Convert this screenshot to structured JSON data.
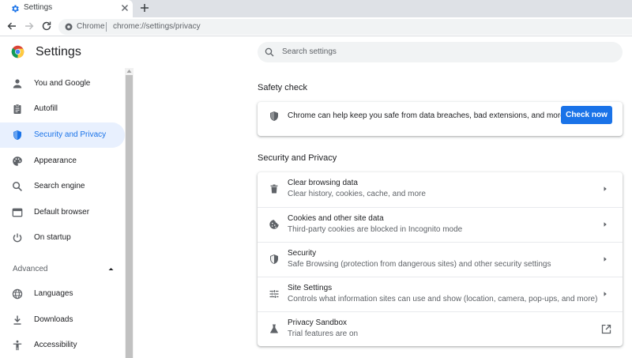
{
  "browser": {
    "tab_title": "Settings",
    "omnibox_label": "Chrome",
    "url": "chrome://settings/privacy"
  },
  "settings": {
    "title": "Settings",
    "search_placeholder": "Search settings"
  },
  "sidebar": {
    "items": [
      {
        "label": "You and Google",
        "icon": "person-icon"
      },
      {
        "label": "Autofill",
        "icon": "clipboard-icon"
      },
      {
        "label": "Security and Privacy",
        "icon": "shield-icon",
        "active": true
      },
      {
        "label": "Appearance",
        "icon": "palette-icon"
      },
      {
        "label": "Search engine",
        "icon": "search-icon"
      },
      {
        "label": "Default browser",
        "icon": "browser-window-icon"
      },
      {
        "label": "On startup",
        "icon": "power-icon"
      }
    ],
    "advanced_label": "Advanced",
    "advanced_items": [
      {
        "label": "Languages",
        "icon": "globe-icon"
      },
      {
        "label": "Downloads",
        "icon": "download-icon"
      },
      {
        "label": "Accessibility",
        "icon": "accessibility-icon"
      }
    ]
  },
  "safety_check": {
    "heading": "Safety check",
    "text": "Chrome can help keep you safe from data breaches, bad extensions, and more",
    "button_label": "Check now"
  },
  "privacy": {
    "heading": "Security and Privacy",
    "rows": [
      {
        "title": "Clear browsing data",
        "subtitle": "Clear history, cookies, cache, and more",
        "icon": "trash-icon"
      },
      {
        "title": "Cookies and other site data",
        "subtitle": "Third-party cookies are blocked in Incognito mode",
        "icon": "cookie-icon"
      },
      {
        "title": "Security",
        "subtitle": "Safe Browsing (protection from dangerous sites) and other security settings",
        "icon": "shield-icon"
      },
      {
        "title": "Site Settings",
        "subtitle": "Controls what information sites can use and show (location, camera, pop-ups, and more)",
        "icon": "tune-icon"
      },
      {
        "title": "Privacy Sandbox",
        "subtitle": "Trial features are on",
        "icon": "flask-icon"
      }
    ]
  },
  "colors": {
    "accent": "#1a73e8",
    "active_bg": "#e8f0fe"
  }
}
